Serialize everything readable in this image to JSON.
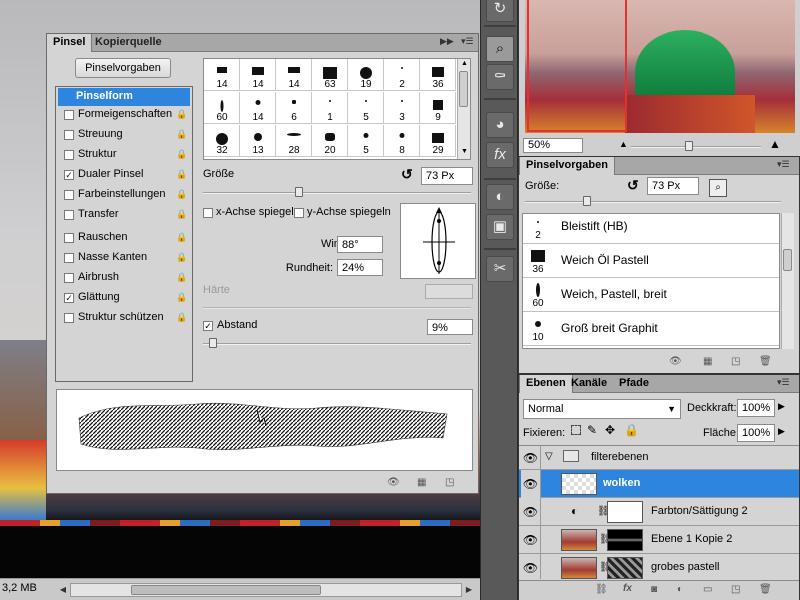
{
  "status": {
    "doc_size": "3,2 MB"
  },
  "pinsel_panel": {
    "tabs": [
      "Pinsel",
      "Kopierquelle"
    ],
    "presets_button": "Pinselvorgaben",
    "categories": [
      {
        "label": "Pinselform",
        "checked": null,
        "selected": true
      },
      {
        "label": "Formeigenschaften",
        "checked": false
      },
      {
        "label": "Streuung",
        "checked": false
      },
      {
        "label": "Struktur",
        "checked": false
      },
      {
        "label": "Dualer Pinsel",
        "checked": true
      },
      {
        "label": "Farbeinstellungen",
        "checked": false
      },
      {
        "label": "Transfer",
        "checked": false
      },
      {
        "label": "Rauschen",
        "checked": false
      },
      {
        "label": "Nasse Kanten",
        "checked": false
      },
      {
        "label": "Airbrush",
        "checked": false
      },
      {
        "label": "Glättung",
        "checked": true
      },
      {
        "label": "Struktur schützen",
        "checked": false
      }
    ],
    "brush_tips": [
      "14",
      "14",
      "14",
      "63",
      "19",
      "2",
      "36",
      "60",
      "14",
      "6",
      "1",
      "5",
      "3",
      "9",
      "32",
      "13",
      "28",
      "20",
      "5",
      "8",
      "29"
    ],
    "groesse_label": "Größe",
    "groesse_value": "73 Px",
    "flip_x": "x-Achse spiegeln",
    "flip_y": "y-Achse spiegeln",
    "winkel_label": "Winkel:",
    "winkel_value": "88°",
    "rundheit_label": "Rundheit:",
    "rundheit_value": "24%",
    "haerte_label": "Härte",
    "abstand_label": "Abstand",
    "abstand_value": "9%",
    "abstand_checked": true
  },
  "pinselvorgaben_panel": {
    "tab": "Pinselvorgaben",
    "groesse_label": "Größe:",
    "groesse_value": "73 Px",
    "items": [
      {
        "size": "2",
        "name": "Bleistift (HB)"
      },
      {
        "size": "36",
        "name": "Weich Öl Pastell"
      },
      {
        "size": "60",
        "name": "Weich, Pastell, breit"
      },
      {
        "size": "10",
        "name": "Groß breit Graphit"
      }
    ]
  },
  "navigator": {
    "zoom": "50%"
  },
  "layers_panel": {
    "tabs": [
      "Ebenen",
      "Kanäle",
      "Pfade"
    ],
    "blend_mode": "Normal",
    "opacity_label": "Deckkraft:",
    "opacity_value": "100%",
    "lock_label": "Fixieren:",
    "fill_label": "Fläche:",
    "fill_value": "100%",
    "layers": [
      {
        "name": "filterebenen",
        "type": "group"
      },
      {
        "name": "wolken",
        "type": "layer",
        "selected": true
      },
      {
        "name": "Farbton/Sättigung 2",
        "type": "adjustment"
      },
      {
        "name": "Ebene 1 Kopie 2",
        "type": "layer"
      },
      {
        "name": "grobes pastell",
        "type": "layer"
      }
    ]
  },
  "colors": {
    "accent": "#2e85de",
    "panel_bg": "#d4d4d4",
    "toolbar": "#595959"
  }
}
